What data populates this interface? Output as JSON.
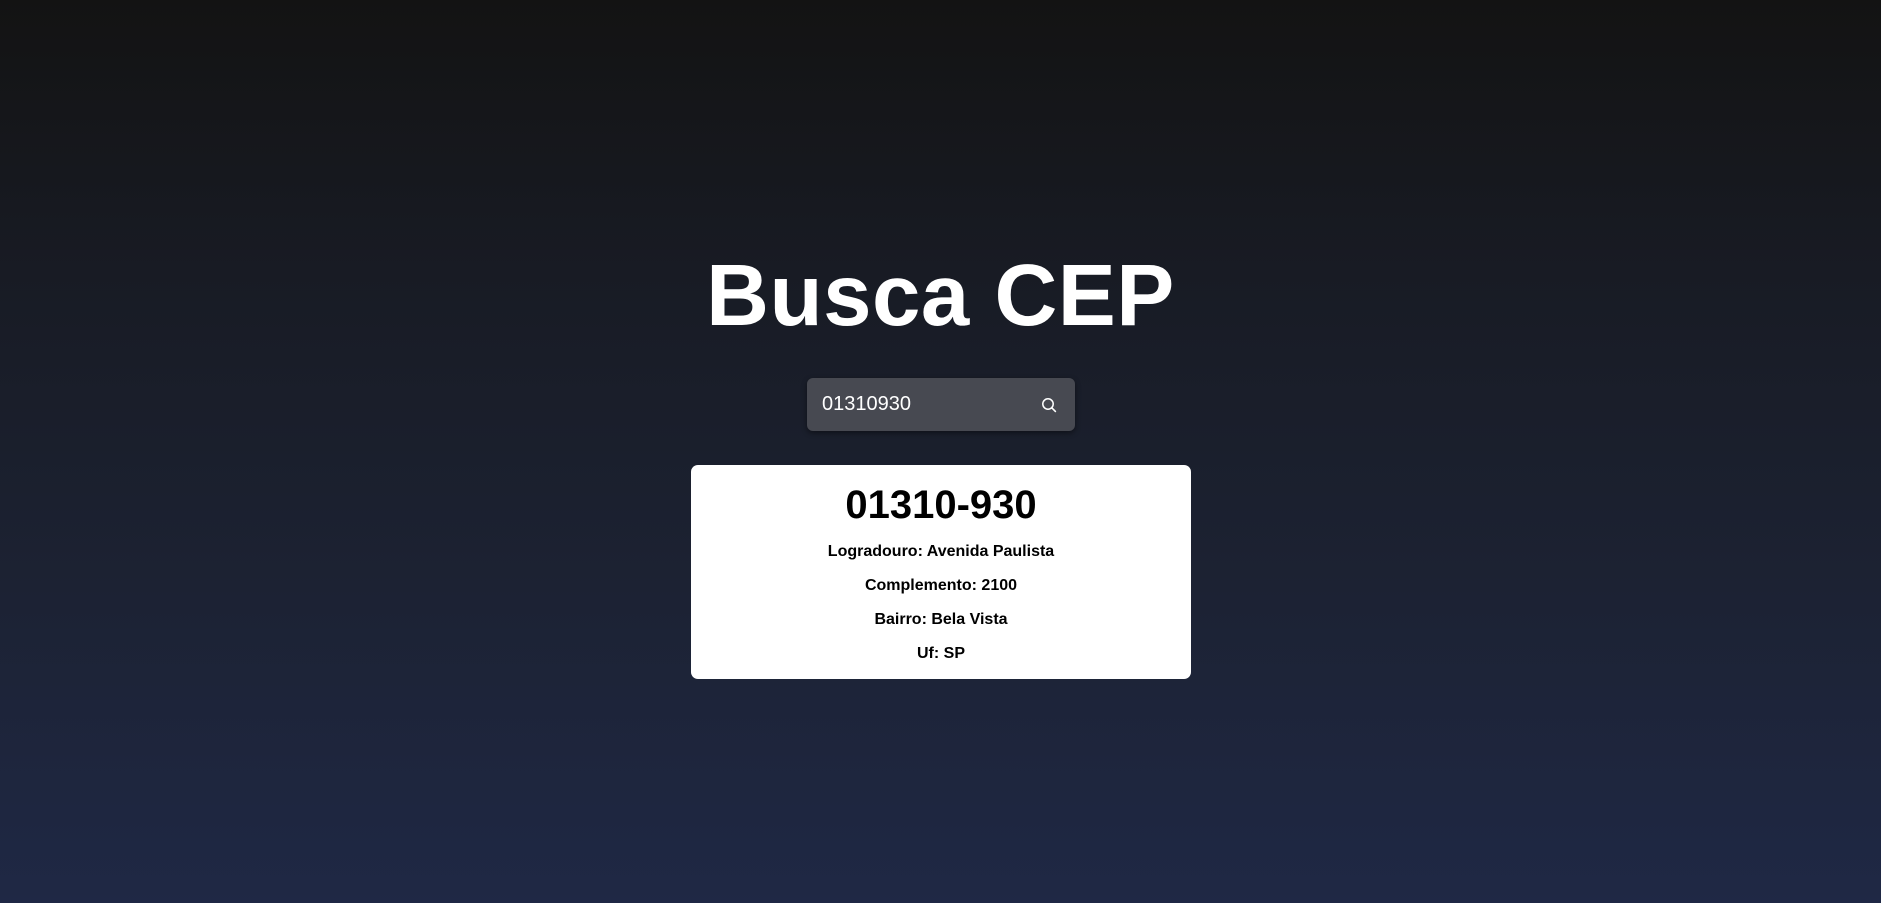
{
  "header": {
    "title": "Busca CEP"
  },
  "search": {
    "value": "01310930",
    "placeholder": "",
    "button_icon": "search-icon"
  },
  "result": {
    "cep": "01310-930",
    "logradouro": "Logradouro: Avenida Paulista",
    "complemento": "Complemento: 2100",
    "bairro": "Bairro: Bela Vista",
    "uf": "Uf: SP"
  },
  "colors": {
    "background_top": "#131313",
    "background_bottom": "#1f2845",
    "search_box": "#474951",
    "card": "#ffffff",
    "title_text": "#ffffff",
    "card_text": "#000000"
  }
}
